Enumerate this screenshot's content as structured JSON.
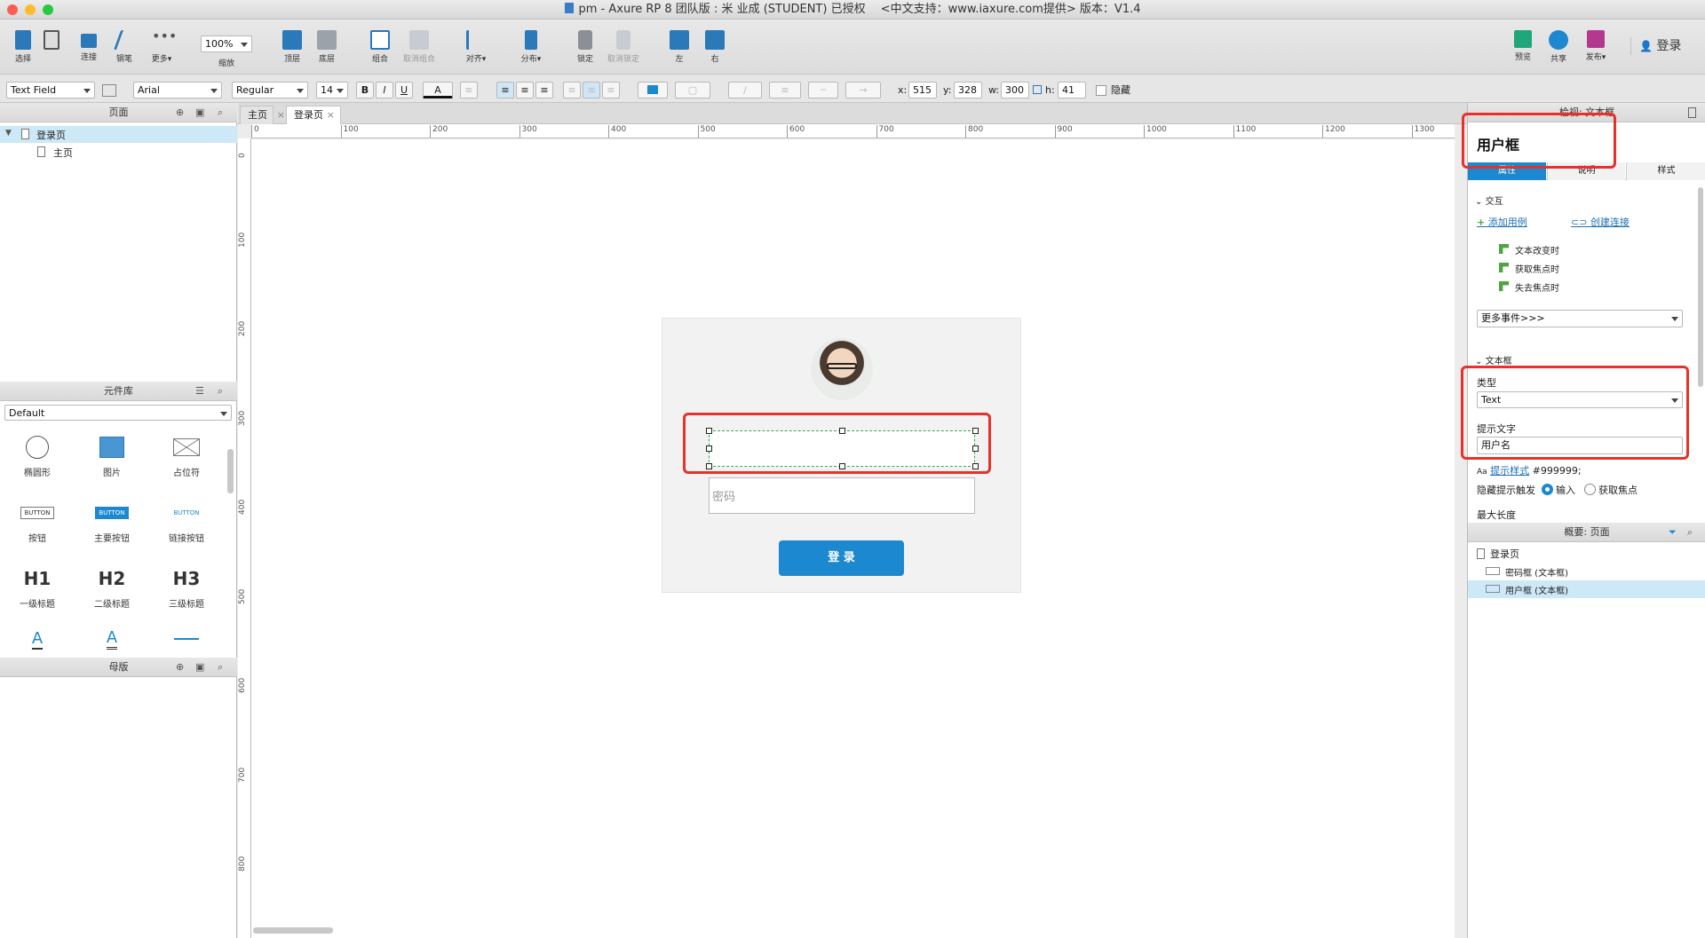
{
  "window": {
    "title": "pm - Axure RP 8 团队版 : 米 业成 (STUDENT) 已授权　 <中文支持：www.iaxure.com提供> 版本：V1.4"
  },
  "toolbar": {
    "select": "选择",
    "connect": "连接",
    "pen": "钢笔",
    "more": "更多▾",
    "zoom_value": "100%",
    "zoom_label": "缩放",
    "top_layer": "顶层",
    "bottom_layer": "底层",
    "group": "组合",
    "ungroup": "取消组合",
    "align": "对齐▾",
    "distribute": "分布▾",
    "lock": "锁定",
    "unlock": "取消锁定",
    "left": "左",
    "right": "右",
    "preview": "预览",
    "share": "共享",
    "publish": "发布▾",
    "login": "登录"
  },
  "format": {
    "widget_type": "Text Field",
    "font": "Arial",
    "weight": "Regular",
    "size": "14",
    "bold": "B",
    "italic": "I",
    "underline": "U",
    "font_color": "A",
    "x_label": "x:",
    "x": "515",
    "y_label": "y:",
    "y": "328",
    "w_label": "w:",
    "w": "300",
    "h_label": "h:",
    "h": "41",
    "hidden": "隐藏"
  },
  "pages_panel": {
    "title": "页面",
    "pages": [
      {
        "label": "登录页"
      },
      {
        "label": "主页"
      }
    ]
  },
  "library": {
    "title": "元件库",
    "selected": "Default",
    "items": [
      {
        "label": "椭圆形"
      },
      {
        "label": "图片"
      },
      {
        "label": "占位符"
      },
      {
        "label": "按钮",
        "text": "BUTTON"
      },
      {
        "label": "主要按钮",
        "text": "BUTTON"
      },
      {
        "label": "链接按钮",
        "text": "BUTTON"
      },
      {
        "label": "一级标题",
        "text": "H1"
      },
      {
        "label": "二级标题",
        "text": "H2"
      },
      {
        "label": "三级标题",
        "text": "H3"
      }
    ],
    "row4": {
      "a": "A",
      "b": "A"
    }
  },
  "masters_panel": {
    "title": "母版"
  },
  "tabs": [
    {
      "label": "主页"
    },
    {
      "label": "登录页"
    }
  ],
  "ruler": {
    "h": [
      "0",
      "100",
      "200",
      "300",
      "400",
      "500",
      "600",
      "700",
      "800",
      "900",
      "1000",
      "1100",
      "1200",
      "1300"
    ],
    "v": [
      "0",
      "100",
      "200",
      "300",
      "400",
      "500",
      "600",
      "700",
      "800"
    ]
  },
  "canvas": {
    "password_placeholder": "密码",
    "login_button": "登 录"
  },
  "inspector": {
    "title": "检视: 文本框",
    "widget_name": "用户框",
    "tabs": [
      "属性",
      "说明",
      "样式"
    ],
    "interaction_section": "交互",
    "add_case": "添加用例",
    "create_link": "创建连接",
    "events": [
      "文本改变时",
      "获取焦点时",
      "失去焦点时"
    ],
    "more_events": "更多事件>>>",
    "textbox_section": "文本框",
    "type_label": "类型",
    "type_value": "Text",
    "hint_label": "提示文字",
    "hint_value": "用户名",
    "hint_style_icon": "Aa",
    "hint_style_link": "提示样式",
    "hint_color": "#999999;",
    "hide_hint_label": "隐藏提示触发",
    "opt_input": "输入",
    "opt_focus": "获取焦点",
    "max_length": "最大长度"
  },
  "outline": {
    "title": "概要: 页面",
    "page": "登录页",
    "items": [
      {
        "label": "密码框 (文本框)"
      },
      {
        "label": "用户框 (文本框)"
      }
    ]
  },
  "colors": {
    "accent": "#1c88cf",
    "highlight": "#e8312a",
    "selected_row": "#cde8f6"
  }
}
